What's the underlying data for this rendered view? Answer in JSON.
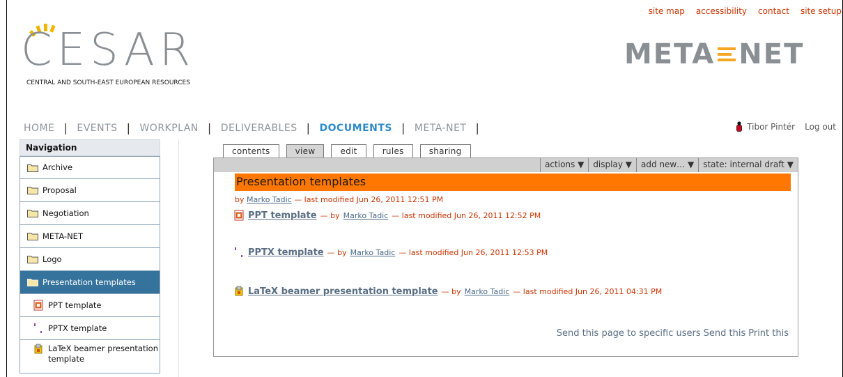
{
  "site_actions": [
    "site map",
    "accessibility",
    "contact",
    "site setup"
  ],
  "logos": {
    "cesar_word": "CESAR",
    "cesar_subtitle": "CENTRAL AND SOUTH-EAST EUROPEAN RESOURCES",
    "metanet_left": "META",
    "metanet_right": "NET"
  },
  "topnav": {
    "items": [
      "HOME",
      "EVENTS",
      "WORKPLAN",
      "DELIVERABLES",
      "DOCUMENTS",
      "META-NET"
    ],
    "active": "DOCUMENTS"
  },
  "user": {
    "name": "Tibor Pintér",
    "logout": "Log out"
  },
  "navigation": {
    "header": "Navigation",
    "items": [
      {
        "label": "Archive",
        "icon": "folder-icon"
      },
      {
        "label": "Proposal",
        "icon": "folder-icon"
      },
      {
        "label": "Negotiation",
        "icon": "folder-icon"
      },
      {
        "label": "META-NET",
        "icon": "folder-icon"
      },
      {
        "label": "Logo",
        "icon": "folder-icon"
      },
      {
        "label": "Presentation templates",
        "icon": "folder-open-icon",
        "selected": true
      },
      {
        "label": "PPT template",
        "icon": "ppt-file-icon"
      },
      {
        "label": "PPTX template",
        "icon": "pptx-file-icon"
      },
      {
        "label": "LaTeX beamer presentation template",
        "icon": "tex-file-icon"
      }
    ]
  },
  "tabs": [
    "contents",
    "view",
    "edit",
    "rules",
    "sharing"
  ],
  "active_tab": "view",
  "action_bar": [
    "actions ▼",
    "display ▼",
    "add new… ▼",
    "state: internal draft ▼"
  ],
  "document": {
    "title": "Presentation templates",
    "byline_prefix": "by",
    "author": "Marko Tadic",
    "byline_suffix": "— last modified Jun 26, 2011 12:51 PM",
    "entries": [
      {
        "title": "PPT template",
        "by": "— by",
        "author": "Marko Tadic",
        "modified": "— last modified Jun 26, 2011 12:52 PM",
        "icon": "ppt-file-icon"
      },
      {
        "title": "PPTX template",
        "by": "— by",
        "author": "Marko Tadic",
        "modified": "— last modified Jun 26, 2011 12:53 PM",
        "icon": "pptx-file-icon"
      },
      {
        "title": "LaTeX beamer presentation template",
        "by": "— by",
        "author": "Marko Tadic",
        "modified": "— last modified Jun 26, 2011 04:31 PM",
        "icon": "tex-file-icon"
      }
    ]
  },
  "document_actions": [
    "Send this page to specific users",
    "Send this",
    "Print this"
  ],
  "colors": {
    "accent": "#ff7700",
    "link": "#cc3300",
    "nav_selected": "#35739d",
    "active_nav": "#2e8bcb"
  }
}
